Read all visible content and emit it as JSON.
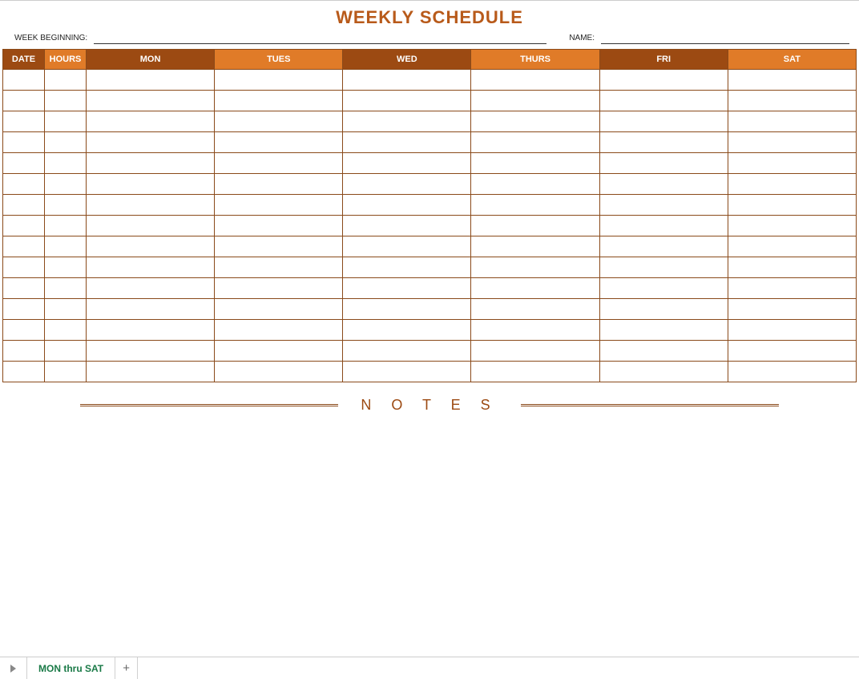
{
  "title": "WEEKLY SCHEDULE",
  "labels": {
    "week_beginning": "WEEK BEGINNING:",
    "name": "NAME:",
    "notes": "N O T E S"
  },
  "table": {
    "headers": {
      "date": "DATE",
      "hours": "HOURS",
      "mon": "MON",
      "tues": "TUES",
      "wed": "WED",
      "thurs": "THURS",
      "fri": "FRI",
      "sat": "SAT"
    },
    "row_count": 15
  },
  "sheet": {
    "tab_name": "MON thru SAT",
    "add_label": "+"
  }
}
